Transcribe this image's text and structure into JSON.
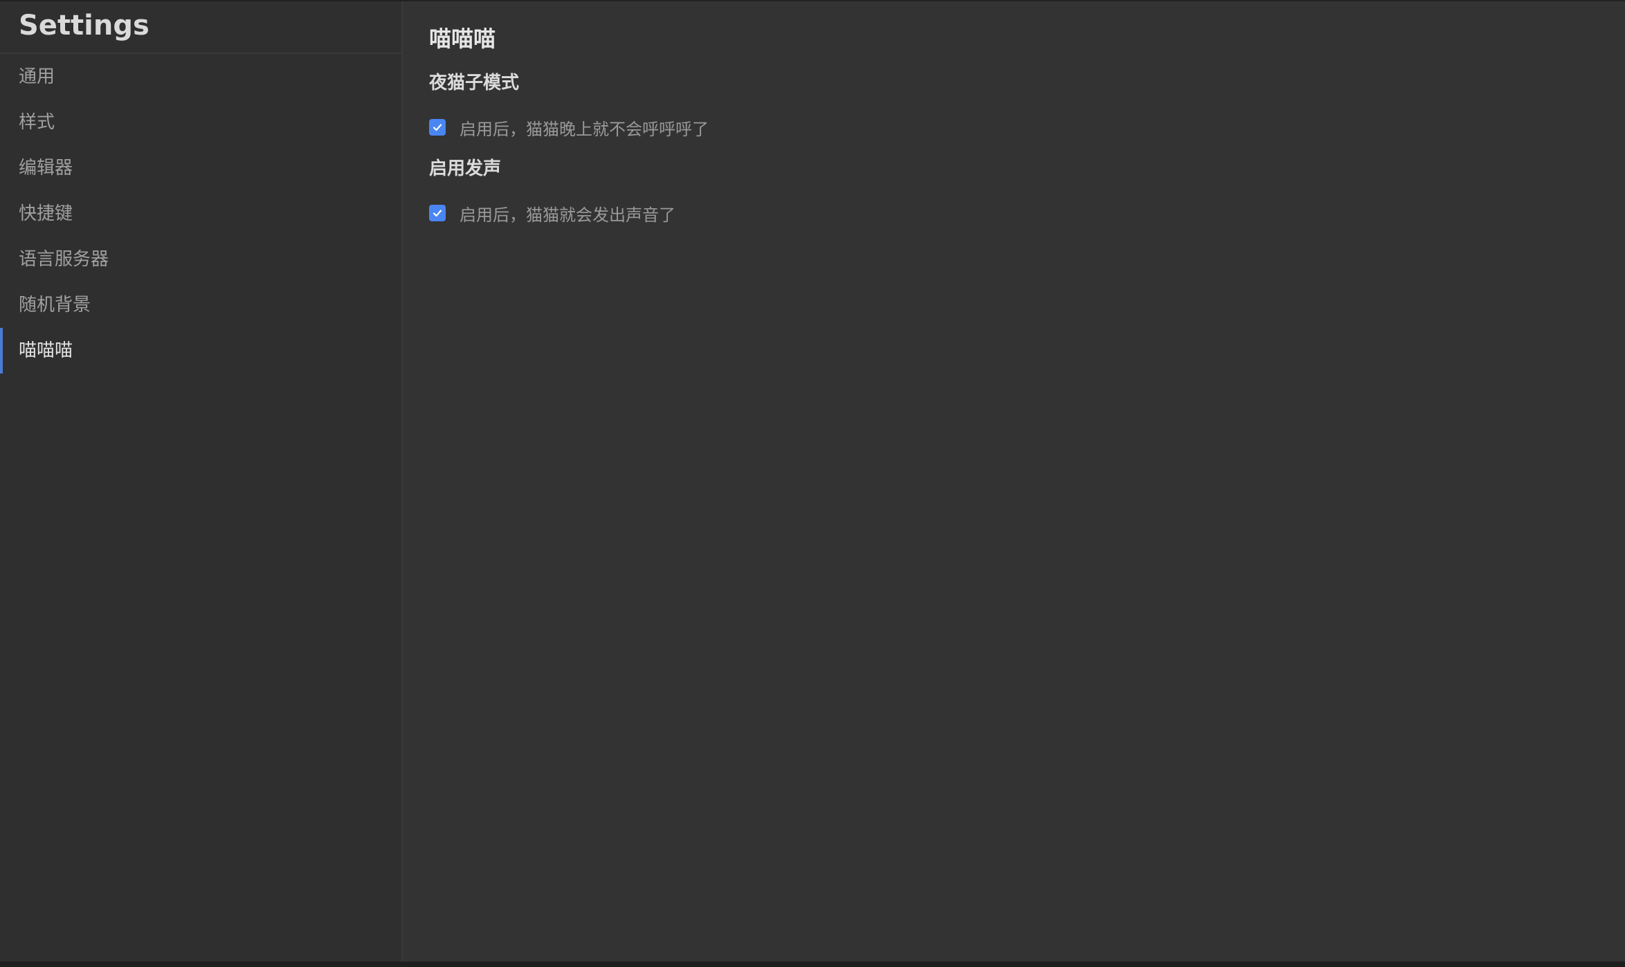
{
  "sidebar": {
    "title": "Settings",
    "items": [
      {
        "label": "通用"
      },
      {
        "label": "样式"
      },
      {
        "label": "编辑器"
      },
      {
        "label": "快捷键"
      },
      {
        "label": "语言服务器"
      },
      {
        "label": "随机背景"
      },
      {
        "label": "喵喵喵"
      }
    ],
    "active_index": 6
  },
  "main": {
    "title": "喵喵喵",
    "sections": [
      {
        "heading": "夜猫子模式",
        "option_label": "启用后，猫猫晚上就不会呼呼呼了",
        "checked": true
      },
      {
        "heading": "启用发声",
        "option_label": "启用后，猫猫就会发出声音了",
        "checked": true
      }
    ]
  },
  "colors": {
    "accent": "#4a86f2",
    "active_indicator": "#4a7cd6",
    "background": "#333333",
    "sidebar_background": "#2f2f2f"
  },
  "icons": {
    "checkbox": "checkmark-icon"
  }
}
